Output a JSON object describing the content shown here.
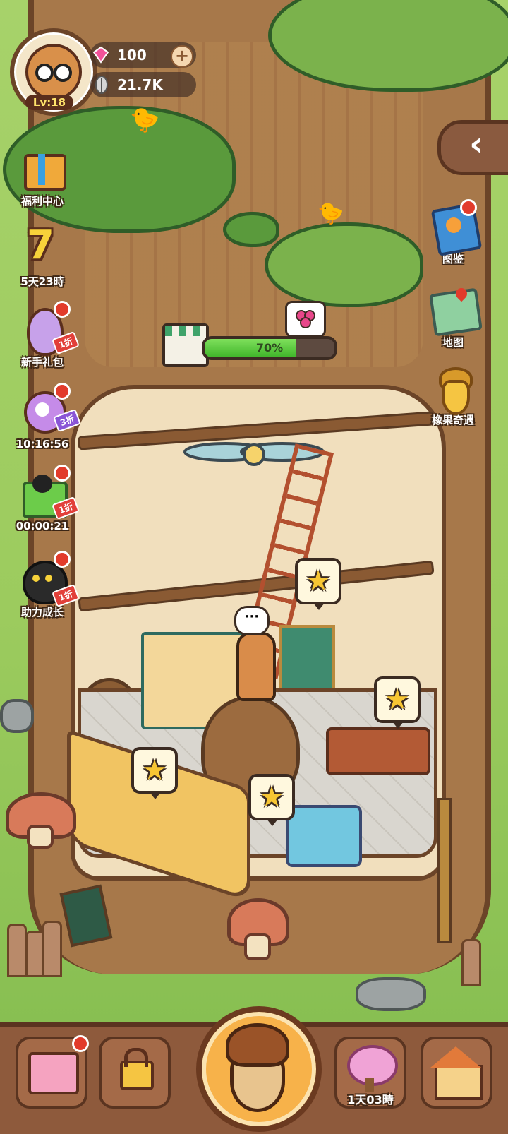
{
  "hud": {
    "level": "Lv:18",
    "gems": "100",
    "seeds": "21.7K",
    "gem_add_icon": "plus-icon"
  },
  "left_menu": [
    {
      "label": "福利中心",
      "icon": "gift-box-icon"
    },
    {
      "label": "5天23時",
      "icon": "seven-day-icon"
    },
    {
      "label": "新手礼包",
      "icon": "egg-clock-icon",
      "badge": "1折"
    },
    {
      "label": "10:16:56",
      "icon": "alarm-clock-icon",
      "badge": "3折"
    },
    {
      "label": "00:00:21",
      "icon": "cat-basket-icon",
      "badge": "1折"
    },
    {
      "label": "助力成长",
      "icon": "black-cat-icon",
      "badge": "1折"
    }
  ],
  "right_menu": [
    {
      "label": "图鉴",
      "icon": "book-icon"
    },
    {
      "label": "地图",
      "icon": "map-icon"
    },
    {
      "label": "橡果奇遇",
      "icon": "golden-acorn-icon"
    }
  ],
  "collapse_icon": "chevron-left-icon",
  "progress": {
    "percent": 70,
    "label": "70%"
  },
  "bottom_bar": {
    "items": [
      {
        "icon": "shop-cart-icon",
        "label": ""
      },
      {
        "icon": "lock-icon",
        "label": ""
      },
      {
        "icon": "acorn-icon",
        "label": ""
      },
      {
        "icon": "cherry-tree-icon",
        "label": "1天03時"
      },
      {
        "icon": "house-icon",
        "label": ""
      }
    ]
  },
  "colors": {
    "accent": "#f7b24a",
    "bark": "#a7784a",
    "leaf": "#5a9a3c",
    "progress_fill": "#3fb52a",
    "notify_dot": "#e23b2b"
  }
}
